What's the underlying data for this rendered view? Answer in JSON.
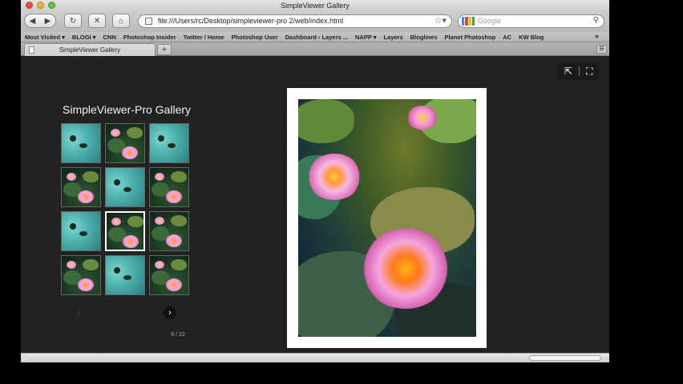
{
  "window": {
    "title": "SimpleViewer Gallery"
  },
  "toolbar": {
    "back_icon": "back-arrow-icon",
    "forward_icon": "forward-arrow-icon",
    "url": "file:///Users/rc/Desktop/simpleviewer-pro 2/web/index.html",
    "search_placeholder": "Google"
  },
  "bookmarks": [
    "Most Visited ▾",
    "BLOGI ▾",
    "CNN",
    "Photoshop Insider",
    "Twitter / Home",
    "Photoshop User",
    "Dashboard ‹ Layers ...",
    "NAPP ▾",
    "Layers",
    "Bloglines",
    "Planet Photoshop",
    "AC",
    "KW Blog"
  ],
  "tab": {
    "label": "SimpleViewer Gallery"
  },
  "gallery": {
    "title": "SimpleViewer-Pro Gallery",
    "counter": "8 / 22",
    "thumbnails": [
      "a",
      "b",
      "a",
      "b",
      "a",
      "b",
      "a",
      "b",
      "b",
      "b",
      "a",
      "b"
    ],
    "selected_index": 7
  },
  "colors": {
    "background": "#222222",
    "frame": "#ffffff",
    "thumb_border": "#666666"
  }
}
